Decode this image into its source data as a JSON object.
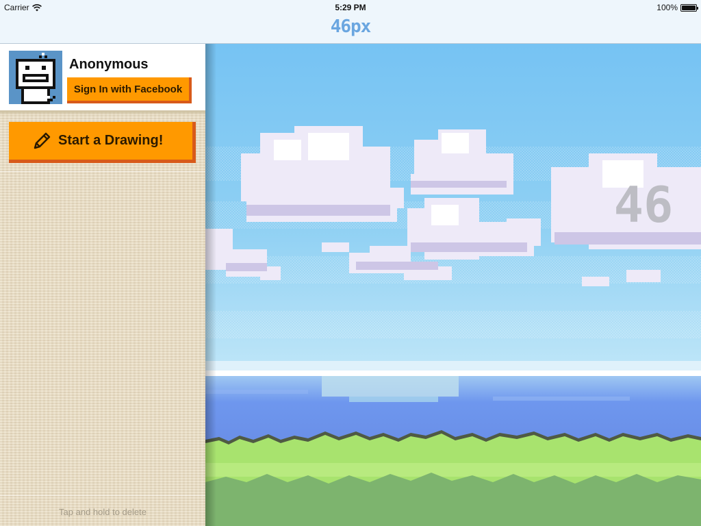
{
  "status_bar": {
    "carrier": "Carrier",
    "time": "5:29 PM",
    "battery": "100%",
    "battery_level": 1.0
  },
  "nav": {
    "title": "46px"
  },
  "profile": {
    "name": "Anonymous",
    "facebook_button": "Sign In with Facebook",
    "avatar_icon": "pixel-robot-avatar"
  },
  "actions": {
    "start_drawing": "Start a Drawing!",
    "start_icon": "pencil-icon"
  },
  "list": {
    "footer_hint": "Tap and hold to delete"
  },
  "scene": {
    "watermark": "46",
    "colors": {
      "sky": "#7cc6f2",
      "sea": "#6a97ef",
      "grass": "#a8e36e",
      "ground": "#7db46e",
      "accent": "#ff9900",
      "accent_dark": "#d85a1a"
    }
  }
}
